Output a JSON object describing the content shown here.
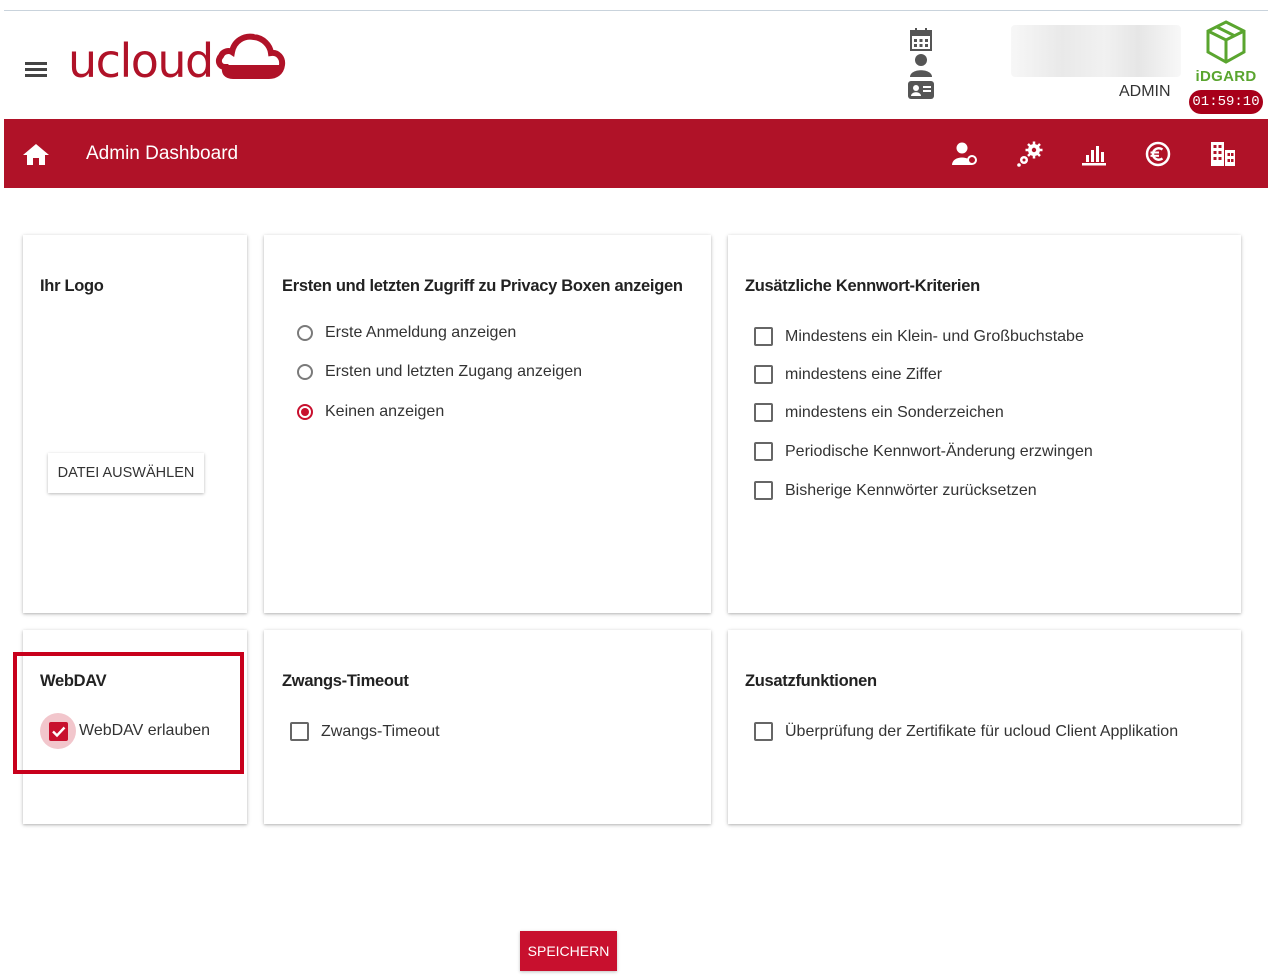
{
  "header": {
    "logo_text": "ucloud",
    "user_role": "ADMIN",
    "brand_text": "iDGARD",
    "session_timer": "01:59:10"
  },
  "nav": {
    "title": "Admin Dashboard",
    "icons": [
      "users-gear-icon",
      "settings-gears-icon",
      "statistics-chart-icon",
      "euro-icon",
      "building-icon"
    ]
  },
  "cards": {
    "logo": {
      "title": "Ihr Logo",
      "button_label": "DATEI AUSWÄHLEN"
    },
    "privacy": {
      "title": "Ersten und letzten Zugriff zu Privacy Boxen anzeigen",
      "options": [
        {
          "label": "Erste Anmeldung anzeigen",
          "selected": false
        },
        {
          "label": "Ersten und letzten Zugang anzeigen",
          "selected": false
        },
        {
          "label": "Keinen anzeigen",
          "selected": true
        }
      ]
    },
    "password": {
      "title": "Zusätzliche Kennwort-Kriterien",
      "options": [
        {
          "label": "Mindestens ein Klein- und Großbuchstabe",
          "checked": false
        },
        {
          "label": "mindestens eine Ziffer",
          "checked": false
        },
        {
          "label": "mindestens ein Sonderzeichen",
          "checked": false
        },
        {
          "label": "Periodische Kennwort-Änderung erzwingen",
          "checked": false
        },
        {
          "label": "Bisherige Kennwörter zurücksetzen",
          "checked": false
        }
      ]
    },
    "webdav": {
      "title": "WebDAV",
      "option_label": "WebDAV erlauben",
      "checked": true
    },
    "timeout": {
      "title": "Zwangs-Timeout",
      "option_label": "Zwangs-Timeout",
      "checked": false
    },
    "extras": {
      "title": "Zusatzfunktionen",
      "option_label": "Überprüfung der Zertifikate für ucloud Client Applikation",
      "checked": false
    }
  },
  "actions": {
    "save_label": "SPEICHERN"
  },
  "colors": {
    "brand_red": "#b01228",
    "accent_red": "#c8102e",
    "idgard_green": "#5aa52f"
  }
}
